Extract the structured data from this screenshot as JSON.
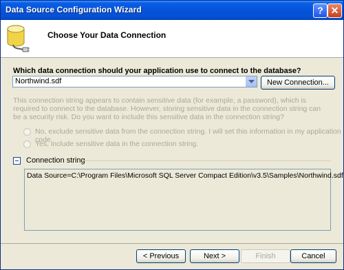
{
  "window": {
    "title": "Data Source Configuration Wizard",
    "help_glyph": "?",
    "close_glyph": "✕"
  },
  "header": {
    "title": "Choose Your Data Connection"
  },
  "connection": {
    "question": "Which data connection should your application use to connect to the database?",
    "selected": "Northwind.sdf",
    "new_connection_label": "New Connection..."
  },
  "sensitive": {
    "warning": "This connection string appears to contain sensitive data (for example, a password), which is required to connect to the database. However, storing sensitive data in the connection string can be a security risk. Do you want to include this sensitive data in the connection string?",
    "option_no": "No, exclude sensitive data from the connection string. I will set this information in my application code.",
    "option_yes": "Yes, include sensitive data in the connection string."
  },
  "connection_string": {
    "label": "Connection string",
    "value": "Data Source=C:\\Program Files\\Microsoft SQL Server Compact Edition\\v3.5\\Samples\\Northwind.sdf"
  },
  "buttons": {
    "previous": "< Previous",
    "next": "Next >",
    "finish": "Finish",
    "cancel": "Cancel"
  }
}
